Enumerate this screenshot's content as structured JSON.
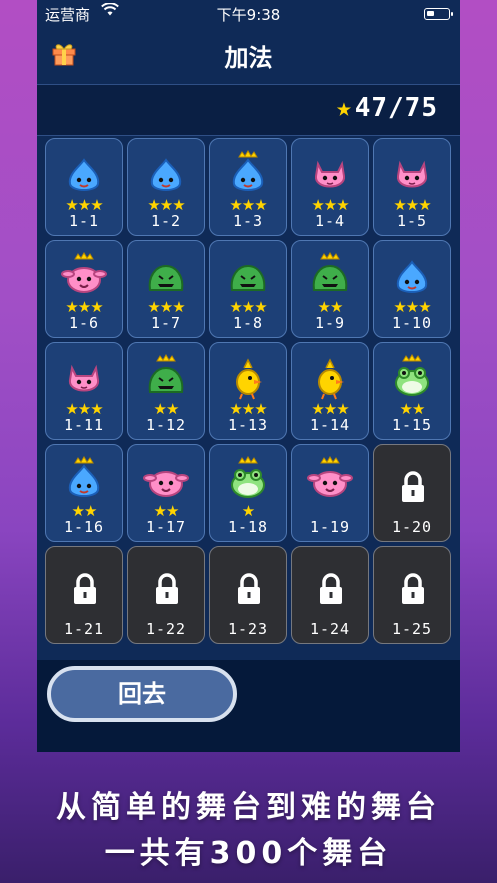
{
  "status": {
    "carrier": "运营商",
    "time": "下午9:38"
  },
  "header": {
    "title": "加法",
    "gift_icon": "gift-icon"
  },
  "score": {
    "star": "★",
    "text": "47/75"
  },
  "colors": {
    "star": "#ffd400",
    "tile": "#1d4077",
    "locked_tile": "#2e2f33",
    "accent": "#ffd400"
  },
  "levels": [
    {
      "label": "1-1",
      "stars": "★★★",
      "char": "blue-slime"
    },
    {
      "label": "1-2",
      "stars": "★★★",
      "char": "blue-slime"
    },
    {
      "label": "1-3",
      "stars": "★★★",
      "char": "crowned-blue-slime"
    },
    {
      "label": "1-4",
      "stars": "★★★",
      "char": "pink-cat"
    },
    {
      "label": "1-5",
      "stars": "★★★",
      "char": "pink-cat"
    },
    {
      "label": "1-6",
      "stars": "★★★",
      "char": "crowned-pink-bunny"
    },
    {
      "label": "1-7",
      "stars": "★★★",
      "char": "green-slime"
    },
    {
      "label": "1-8",
      "stars": "★★★",
      "char": "green-slime"
    },
    {
      "label": "1-9",
      "stars": "★★",
      "char": "crowned-green-slime"
    },
    {
      "label": "1-10",
      "stars": "★★★",
      "char": "blue-slime"
    },
    {
      "label": "1-11",
      "stars": "★★★",
      "char": "pink-cat"
    },
    {
      "label": "1-12",
      "stars": "★★",
      "char": "crowned-green-slime"
    },
    {
      "label": "1-13",
      "stars": "★★★",
      "char": "yellow-chick"
    },
    {
      "label": "1-14",
      "stars": "★★★",
      "char": "yellow-chick"
    },
    {
      "label": "1-15",
      "stars": "★★",
      "char": "crowned-frog"
    },
    {
      "label": "1-16",
      "stars": "★★",
      "char": "crowned-blue-slime"
    },
    {
      "label": "1-17",
      "stars": "★★",
      "char": "pink-bunny"
    },
    {
      "label": "1-18",
      "stars": "★",
      "char": "crowned-frog"
    },
    {
      "label": "1-19",
      "stars": "",
      "char": "crowned-pink-bunny"
    },
    {
      "label": "1-20",
      "stars": "",
      "char": "lock"
    },
    {
      "label": "1-21",
      "stars": "",
      "char": "lock"
    },
    {
      "label": "1-22",
      "stars": "",
      "char": "lock"
    },
    {
      "label": "1-23",
      "stars": "",
      "char": "lock"
    },
    {
      "label": "1-24",
      "stars": "",
      "char": "lock"
    },
    {
      "label": "1-25",
      "stars": "",
      "char": "lock"
    }
  ],
  "back_button": "回去",
  "promo": {
    "line1": "从简单的舞台到难的舞台",
    "line2": "一共有300个舞台"
  }
}
